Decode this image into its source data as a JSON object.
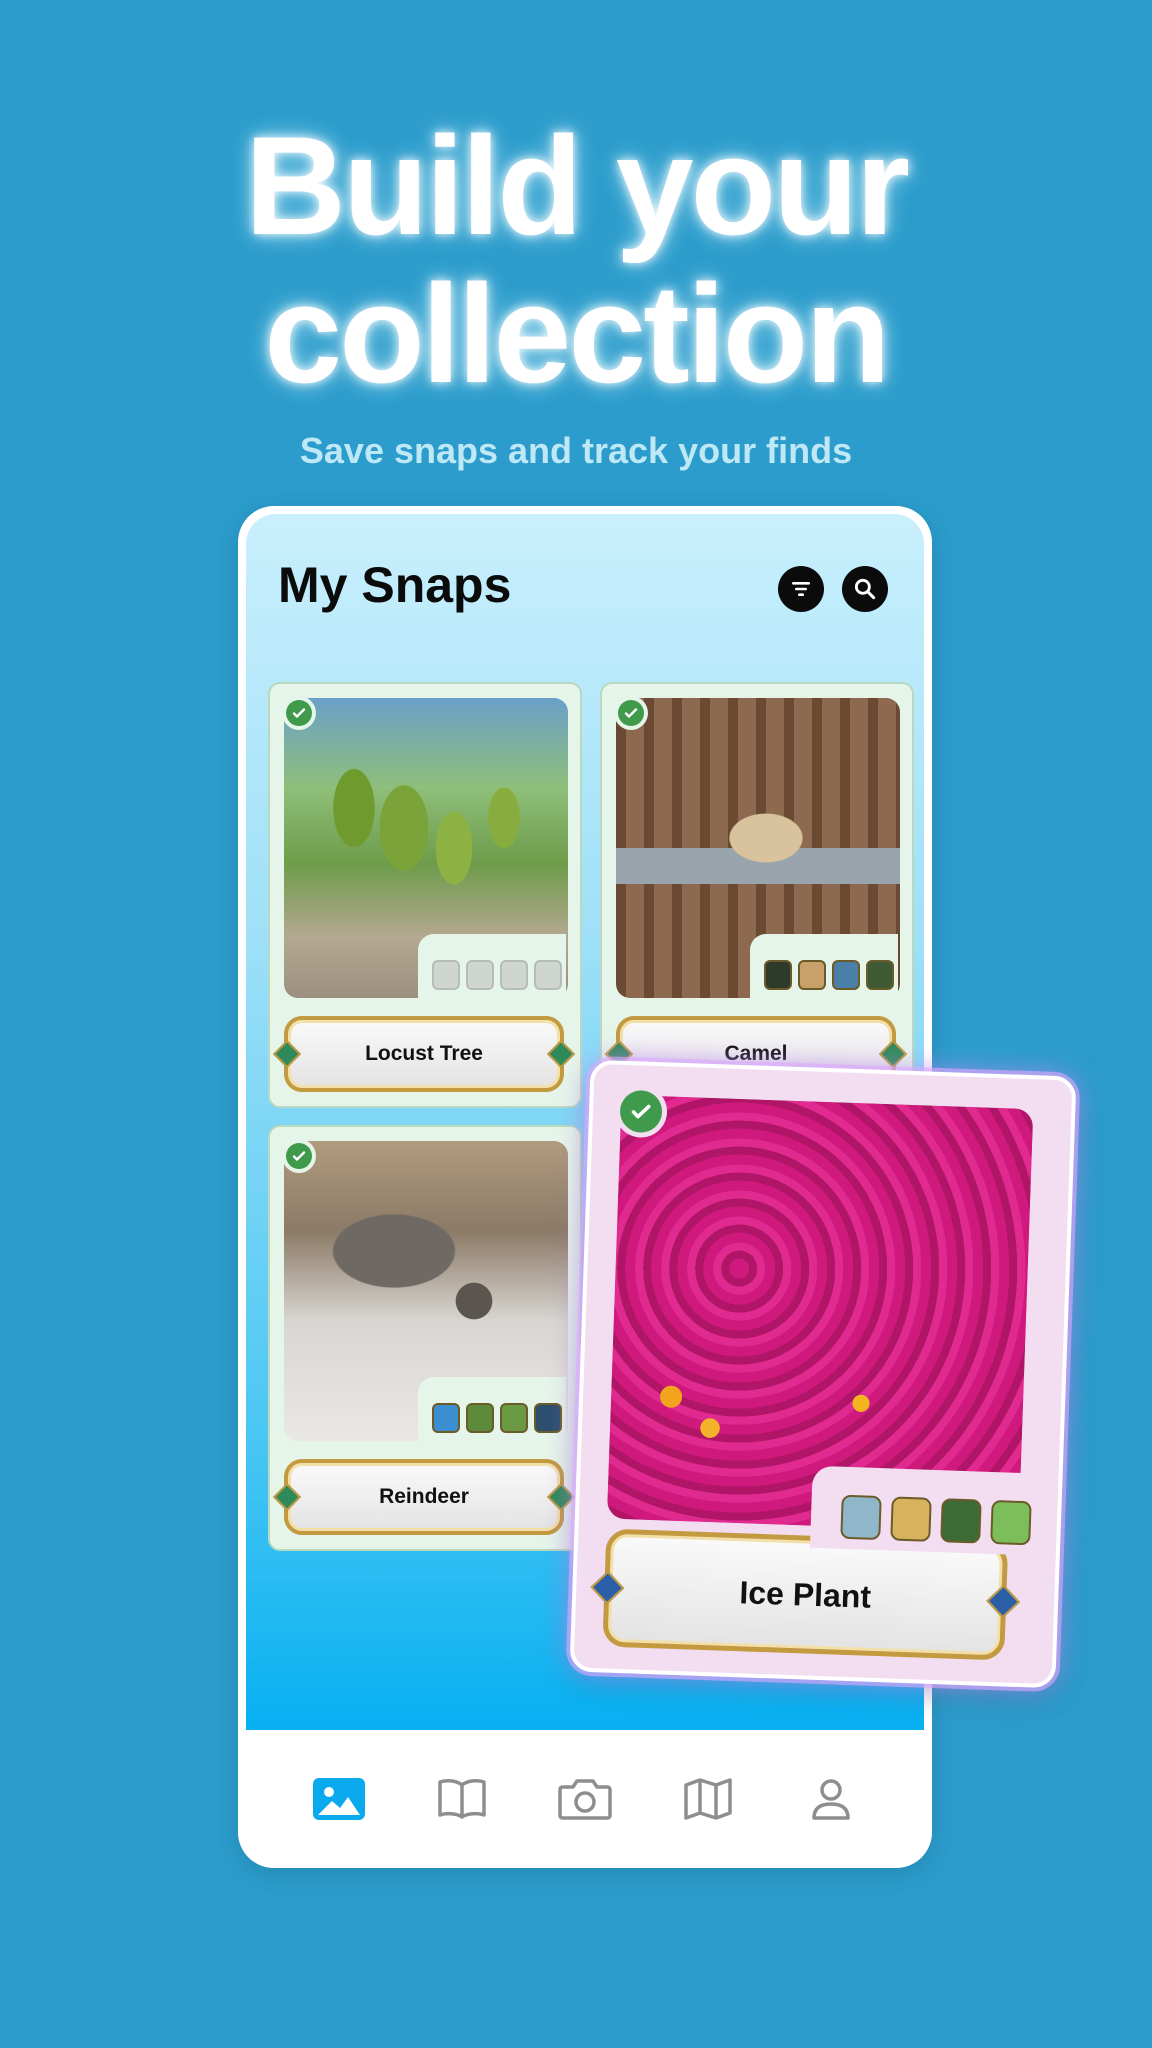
{
  "headline": {
    "line1": "Build your",
    "line2": "collection"
  },
  "subheadline": "Save snaps and track your finds",
  "app": {
    "title": "My Snaps",
    "buttons": {
      "filter_icon": "filter-icon",
      "search_icon": "search-icon"
    }
  },
  "cards": [
    {
      "name": "Locust Tree",
      "collected": true,
      "badges": [
        "empty",
        "empty",
        "empty",
        "empty"
      ]
    },
    {
      "name": "Camel",
      "collected": true,
      "badges": [
        "sun",
        "cactus",
        "landscape",
        "trail"
      ]
    },
    {
      "name": "Reindeer",
      "collected": true,
      "badges": [
        "water",
        "leaf",
        "leaf",
        "trail"
      ]
    }
  ],
  "featured_card": {
    "name": "Ice Plant",
    "collected": true,
    "badges": [
      "water",
      "cactus",
      "tree",
      "flower"
    ]
  },
  "tabbar": {
    "items": [
      {
        "icon": "photos-icon",
        "active": true
      },
      {
        "icon": "book-icon",
        "active": false
      },
      {
        "icon": "camera-icon",
        "active": false
      },
      {
        "icon": "map-icon",
        "active": false
      },
      {
        "icon": "profile-icon",
        "active": false
      }
    ]
  },
  "colors": {
    "background": "#2b9ccc",
    "accent": "#0aa9ee",
    "check": "#3f9b4b",
    "featured_glow": "#d3a6ff"
  }
}
